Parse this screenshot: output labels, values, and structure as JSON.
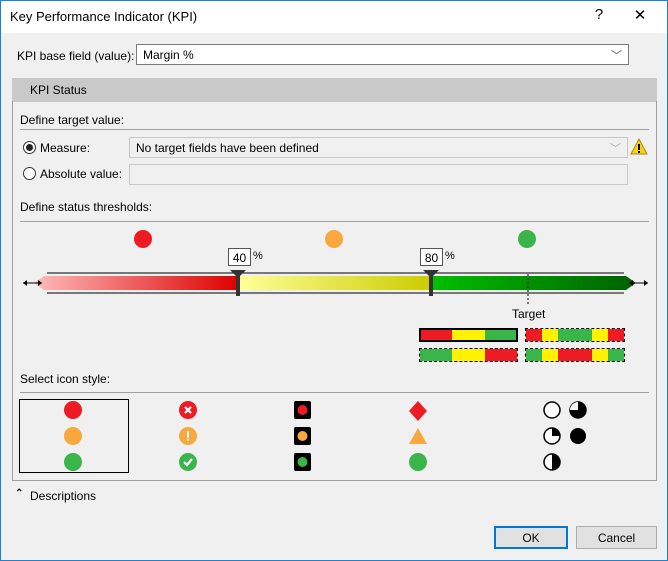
{
  "dialog": {
    "title": "Key Performance Indicator (KPI)",
    "help": "?",
    "close": "✕"
  },
  "base_field": {
    "label": "KPI base field (value):",
    "value": "Margin %"
  },
  "kpi_status": {
    "header": "KPI Status",
    "target": {
      "heading": "Define target value:",
      "measure_label": "Measure:",
      "measure_value": "No target fields have been defined",
      "measure_selected": true,
      "absolute_label": "Absolute value:",
      "absolute_value": ""
    },
    "thresholds": {
      "heading": "Define status thresholds:",
      "low": "40",
      "high": "80",
      "unit": "%",
      "target_label": "Target"
    },
    "icon_style": {
      "heading": "Select icon style:"
    }
  },
  "colors": {
    "red": "#ed1c24",
    "yellow": "#f8a83c",
    "green": "#39b54a",
    "accent": "#0078d7"
  },
  "descriptions": {
    "label": "Descriptions"
  },
  "buttons": {
    "ok": "OK",
    "cancel": "Cancel"
  }
}
